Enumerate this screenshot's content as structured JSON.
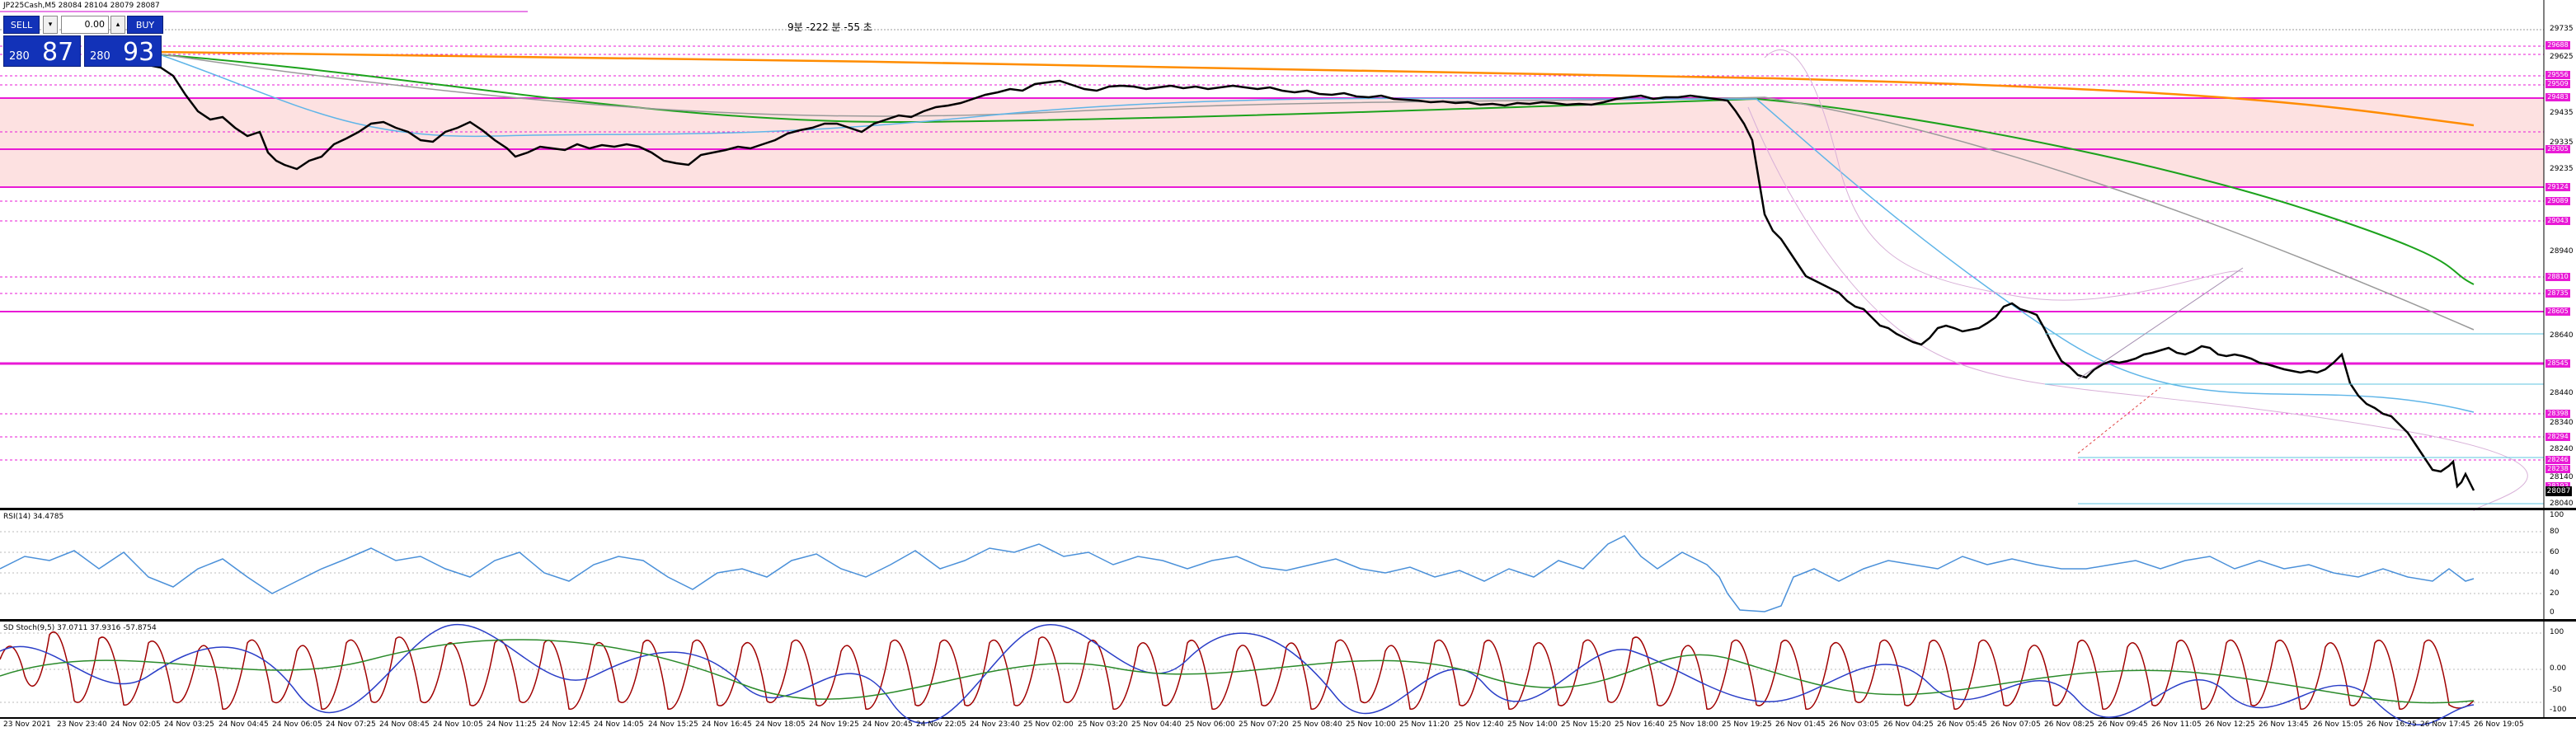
{
  "symbol_info": "JP225Cash,M5  28084 28104 28079 28087",
  "timer_text": "9분 -222 분 -55 초",
  "trade_panel": {
    "sell_label": "SELL",
    "buy_label": "BUY",
    "volume": "0.00",
    "sell_small": "280",
    "sell_big": "87",
    "buy_small": "280",
    "buy_big": "93",
    "dropdown_icon": "▾",
    "colors": {
      "button": "#1232b8"
    }
  },
  "price_axis": {
    "labels": [
      "29735",
      "29625",
      "29435",
      "29335",
      "29235",
      "28940",
      "28640",
      "28440",
      "28340",
      "28240",
      "28140",
      "28040"
    ],
    "tags": [
      "29688",
      "29556",
      "29509",
      "29483",
      "29305",
      "29124",
      "29089",
      "29043",
      "28810",
      "28735",
      "28605",
      "28545",
      "28398",
      "28294",
      "28246",
      "28238",
      "28193"
    ],
    "current_price": "28087"
  },
  "rsi": {
    "label": "RSI(14) 34.4785",
    "levels": [
      "100",
      "80",
      "60",
      "40",
      "20",
      "0"
    ]
  },
  "stoch": {
    "label": "SD Stoch(9,5) 37.0711 37.9316 -57.8754",
    "levels": [
      "100",
      "0.00",
      "-50",
      "-100"
    ]
  },
  "time_axis": [
    "23 Nov 2021",
    "23 Nov 23:40",
    "24 Nov 02:05",
    "24 Nov 03:25",
    "24 Nov 04:45",
    "24 Nov 06:05",
    "24 Nov 07:25",
    "24 Nov 08:45",
    "24 Nov 10:05",
    "24 Nov 11:25",
    "24 Nov 12:45",
    "24 Nov 14:05",
    "24 Nov 15:25",
    "24 Nov 16:45",
    "24 Nov 18:05",
    "24 Nov 19:25",
    "24 Nov 20:45",
    "24 Nov 22:05",
    "24 Nov 23:40",
    "25 Nov 02:00",
    "25 Nov 03:20",
    "25 Nov 04:40",
    "25 Nov 06:00",
    "25 Nov 07:20",
    "25 Nov 08:40",
    "25 Nov 10:00",
    "25 Nov 11:20",
    "25 Nov 12:40",
    "25 Nov 14:00",
    "25 Nov 15:20",
    "25 Nov 16:40",
    "25 Nov 18:00",
    "25 Nov 19:25",
    "26 Nov 01:45",
    "26 Nov 03:05",
    "26 Nov 04:25",
    "26 Nov 05:45",
    "26 Nov 07:05",
    "26 Nov 08:25",
    "26 Nov 09:45",
    "26 Nov 11:05",
    "26 Nov 12:25",
    "26 Nov 13:45",
    "26 Nov 15:05",
    "26 Nov 16:25",
    "26 Nov 17:45",
    "26 Nov 19:05"
  ],
  "chart_data": {
    "type": "candlestick",
    "title": "JP225Cash,M5",
    "ylim": [
      28020,
      29770
    ],
    "approx_close_path": [
      {
        "t": "23 Nov 2021",
        "price": 29660
      },
      {
        "t": "24 Nov 02:05",
        "price": 29610
      },
      {
        "t": "24 Nov 04:45",
        "price": 29290
      },
      {
        "t": "24 Nov 06:05",
        "price": 29230
      },
      {
        "t": "24 Nov 07:25",
        "price": 29390
      },
      {
        "t": "24 Nov 10:05",
        "price": 29360
      },
      {
        "t": "24 Nov 11:25",
        "price": 29250
      },
      {
        "t": "24 Nov 14:05",
        "price": 29305
      },
      {
        "t": "24 Nov 16:45",
        "price": 29245
      },
      {
        "t": "24 Nov 19:25",
        "price": 29390
      },
      {
        "t": "24 Nov 22:05",
        "price": 29430
      },
      {
        "t": "25 Nov 02:00",
        "price": 29560
      },
      {
        "t": "25 Nov 04:40",
        "price": 29510
      },
      {
        "t": "25 Nov 07:20",
        "price": 29520
      },
      {
        "t": "25 Nov 11:20",
        "price": 29485
      },
      {
        "t": "25 Nov 15:20",
        "price": 29470
      },
      {
        "t": "25 Nov 18:00",
        "price": 29500
      },
      {
        "t": "25 Nov 19:25",
        "price": 29495
      },
      {
        "t": "26 Nov 01:45",
        "price": 29100
      },
      {
        "t": "26 Nov 04:25",
        "price": 28780
      },
      {
        "t": "26 Nov 05:45",
        "price": 28640
      },
      {
        "t": "26 Nov 07:05",
        "price": 28720
      },
      {
        "t": "26 Nov 08:25",
        "price": 28740
      },
      {
        "t": "26 Nov 09:45",
        "price": 28520
      },
      {
        "t": "26 Nov 11:05",
        "price": 28590
      },
      {
        "t": "26 Nov 12:25",
        "price": 28610
      },
      {
        "t": "26 Nov 13:45",
        "price": 28580
      },
      {
        "t": "26 Nov 15:05",
        "price": 28560
      },
      {
        "t": "26 Nov 16:25",
        "price": 28420
      },
      {
        "t": "26 Nov 17:45",
        "price": 28140
      },
      {
        "t": "26 Nov 19:05",
        "price": 28087
      }
    ]
  }
}
